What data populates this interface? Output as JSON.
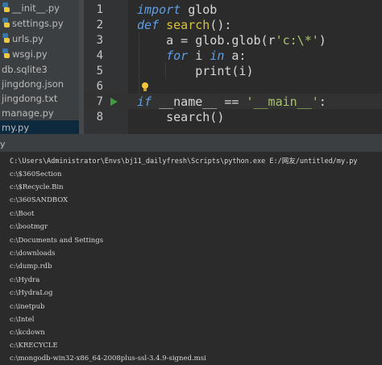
{
  "project_files": [
    {
      "name": "__init__.py",
      "icon": "python-file-icon"
    },
    {
      "name": "settings.py",
      "icon": "python-file-icon"
    },
    {
      "name": "urls.py",
      "icon": "python-file-icon"
    },
    {
      "name": "wsgi.py",
      "icon": "python-file-icon"
    },
    {
      "name": "db.sqlite3"
    },
    {
      "name": "jingdong.json"
    },
    {
      "name": "jingdong.txt"
    },
    {
      "name": "manage.py"
    },
    {
      "name": "my.py",
      "selected": true
    }
  ],
  "editor": {
    "line_numbers": [
      "1",
      "2",
      "3",
      "4",
      "5",
      "6",
      "7",
      "8"
    ],
    "lines": {
      "l1": {
        "kw": "import",
        "rest": " glob"
      },
      "l2": {
        "kw": "def",
        "fn": "search",
        "rest": "():"
      },
      "l3": {
        "a": "    a = glob.glob(r",
        "s": "'c:\\*'",
        "b": ")"
      },
      "l4": {
        "indent": "    ",
        "kw1": "for",
        "mid1": " i ",
        "kw2": "in",
        "mid2": " a:"
      },
      "l5": {
        "text": "        print(i)"
      },
      "l7": {
        "kw": "if",
        "a": " __name__ == ",
        "s": "'__main__'",
        "b": ":"
      },
      "l8": {
        "text": "    search()"
      }
    }
  },
  "run_panel": {
    "title": "y"
  },
  "console_lines": [
    "C:\\Users\\Administrator\\Envs\\bj11_dailyfresh\\Scripts\\python.exe E:/网友/untitled/my.py",
    "c:\\$360Section",
    "c:\\$Recycle.Bin",
    "c:\\360SANDBOX",
    "c:\\Boot",
    "c:\\bootmgr",
    "c:\\Documents and Settings",
    "c:\\downloads",
    "c:\\dump.rdb",
    "c:\\Hydra",
    "c:\\HydraLog",
    "c:\\inetpub",
    "c:\\Intel",
    "c:\\kcdown",
    "c:\\KRECYCLE",
    "c:\\mongodb-win32-x86_64-2008plus-ssl-3.4.9-signed.msi"
  ],
  "colors": {
    "keyword": "#5f9fe3",
    "function": "#d7c33f",
    "string": "#a7c56b",
    "run_arrow": "#3d9e42"
  }
}
